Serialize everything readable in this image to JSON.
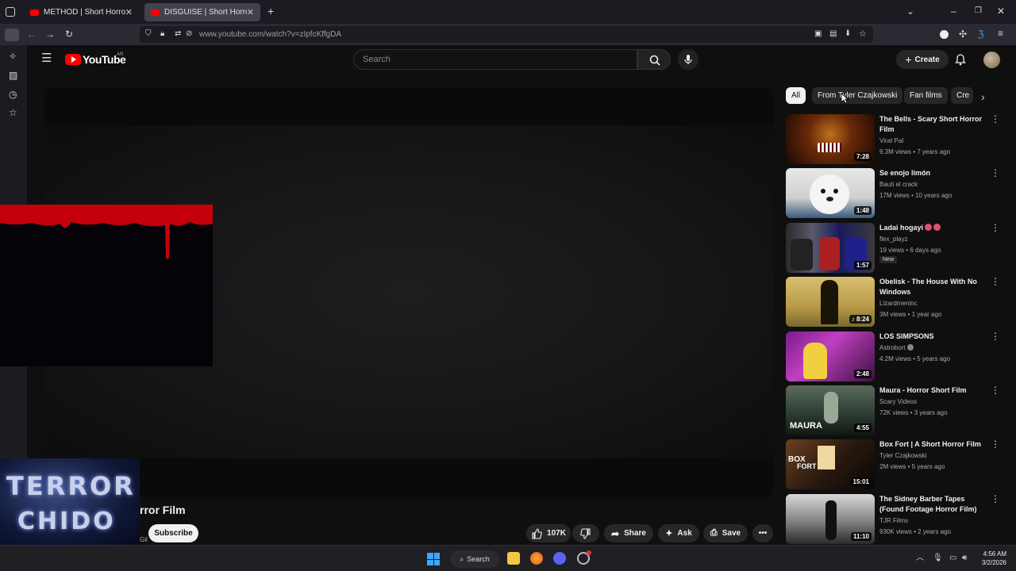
{
  "browser": {
    "tabs": [
      {
        "title": "METHOD | Short Horror Film - YouTube"
      },
      {
        "title": "DISGUISE | Short Horror Film - YouTube"
      }
    ],
    "url": "www.youtube.com/watch?v=zIpfcKffgDA"
  },
  "youtube": {
    "logo_text": "YouTube",
    "country_code": "AR",
    "search_placeholder": "Search",
    "create_label": "Create"
  },
  "video": {
    "title_partial": "rror Film",
    "channel_partial": "Gil",
    "subscribe_label": "Subscribe",
    "likes": "107K",
    "share_label": "Share",
    "ask_label": "Ask",
    "save_label": "Save"
  },
  "overlays": {
    "watermark_line1": "TERROR",
    "watermark_line2": "CHIDO"
  },
  "chips": [
    "All",
    "From Tyler Czajkowski",
    "Fan films",
    "Cre"
  ],
  "recommendations": [
    {
      "title": "The Bells - Scary Short Horror Film",
      "channel": "Virat Pal",
      "meta": "9.3M views • 7 years ago",
      "duration": "7:28"
    },
    {
      "title": "Se enojo limón",
      "channel": "Bauti el crack",
      "meta": "17M views • 10 years ago",
      "duration": "1:48"
    },
    {
      "title": "Ladai hogayi",
      "channel": "flex_playz",
      "meta": "19 views • 6 days ago",
      "badge": "New",
      "duration": "1:57"
    },
    {
      "title": "Obelisk - The House With No Windows",
      "channel": "Lizardmeninc",
      "meta": "3M views • 1 year ago",
      "duration": "8:24"
    },
    {
      "title": "LOS SIMPSONS",
      "channel": "Astrobort",
      "meta": "4.2M views • 5 years ago",
      "duration": "2:48"
    },
    {
      "title": "Maura - Horror Short Film",
      "channel": "Scary Videos",
      "meta": "72K views • 3 years ago",
      "duration": "4:55",
      "thumb_text": "MAURA"
    },
    {
      "title": "Box Fort | A Short Horror Film",
      "channel": "Tyler Czajkowski",
      "meta": "2M views • 5 years ago",
      "duration": "15:01",
      "thumb_text_1": "BOX",
      "thumb_text_2": "FORT"
    },
    {
      "title": "The Sidney Barber Tapes (Found Footage Horror Film)",
      "channel": "TJR Films",
      "meta": "930K views • 2 years ago",
      "duration": "11:10"
    }
  ],
  "taskbar": {
    "search_label": "Search",
    "time": "4:56 AM",
    "date": "3/2/2026"
  }
}
